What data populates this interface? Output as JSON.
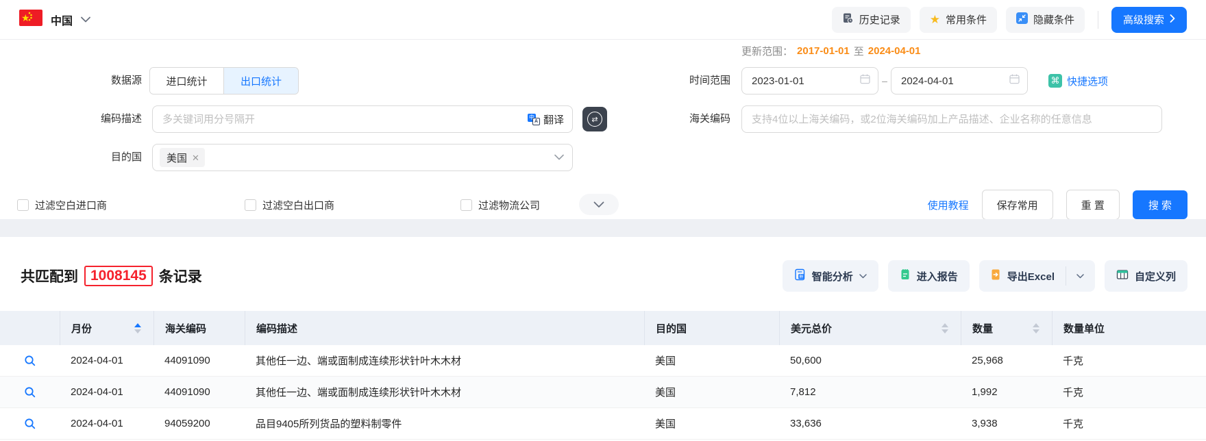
{
  "topbar": {
    "country": "中国",
    "history_label": "历史记录",
    "favorites_label": "常用条件",
    "hide_label": "隐藏条件",
    "advanced_label": "高级搜索"
  },
  "filters": {
    "update_range": {
      "label": "更新范围：",
      "from": "2017-01-01",
      "joiner": "至",
      "to": "2024-04-01"
    },
    "data_source": {
      "label": "数据源",
      "tab_import": "进口统计",
      "tab_export": "出口统计"
    },
    "time_range": {
      "label": "时间范围",
      "from": "2023-01-01",
      "separator": "–",
      "to": "2024-04-01",
      "quick_label": "快捷选项",
      "cmd_glyph": "⌘"
    },
    "code_desc": {
      "label": "编码描述",
      "placeholder": "多关键词用分号隔开",
      "translate_label": "翻译",
      "swap_glyph": "⇄"
    },
    "hs_code": {
      "label": "海关编码",
      "placeholder": "支持4位以上海关编码，或2位海关编码加上产品描述、企业名称的任意信息"
    },
    "destination": {
      "label": "目的国",
      "tag": "美国",
      "tag_close": "✕"
    },
    "checkboxes": [
      {
        "label": "过滤空白进口商",
        "checked": false
      },
      {
        "label": "过滤空白出口商",
        "checked": false
      },
      {
        "label": "过滤物流公司",
        "checked": false
      }
    ],
    "actions": {
      "tutorial": "使用教程",
      "save": "保存常用",
      "reset": "重 置",
      "search": "搜 索"
    }
  },
  "results": {
    "summary": {
      "prefix": "共匹配到",
      "count": "1008145",
      "suffix": "条记录"
    },
    "toolbar": {
      "analyze": "智能分析",
      "report": "进入报告",
      "export": "导出Excel",
      "columns": "自定义列"
    },
    "table": {
      "headers": [
        "",
        "月份",
        "海关编码",
        "编码描述",
        "目的国",
        "美元总价",
        "数量",
        "数量单位"
      ],
      "rows": [
        {
          "month": "2024-04-01",
          "hs_code": "44091090",
          "description": "其他任一边、端或面制成连续形状针叶木木材",
          "destination": "美国",
          "usd_total": "50,600",
          "quantity": "25,968",
          "unit": "千克"
        },
        {
          "month": "2024-04-01",
          "hs_code": "44091090",
          "description": "其他任一边、端或面制成连续形状针叶木木材",
          "destination": "美国",
          "usd_total": "7,812",
          "quantity": "1,992",
          "unit": "千克"
        },
        {
          "month": "2024-04-01",
          "hs_code": "94059200",
          "description": "品目9405所列货品的塑料制零件",
          "destination": "美国",
          "usd_total": "33,636",
          "quantity": "3,938",
          "unit": "千克"
        }
      ]
    }
  },
  "colors": {
    "primary": "#1677ff",
    "date_highlight": "#fa8c16",
    "count_red": "#f5222d"
  }
}
